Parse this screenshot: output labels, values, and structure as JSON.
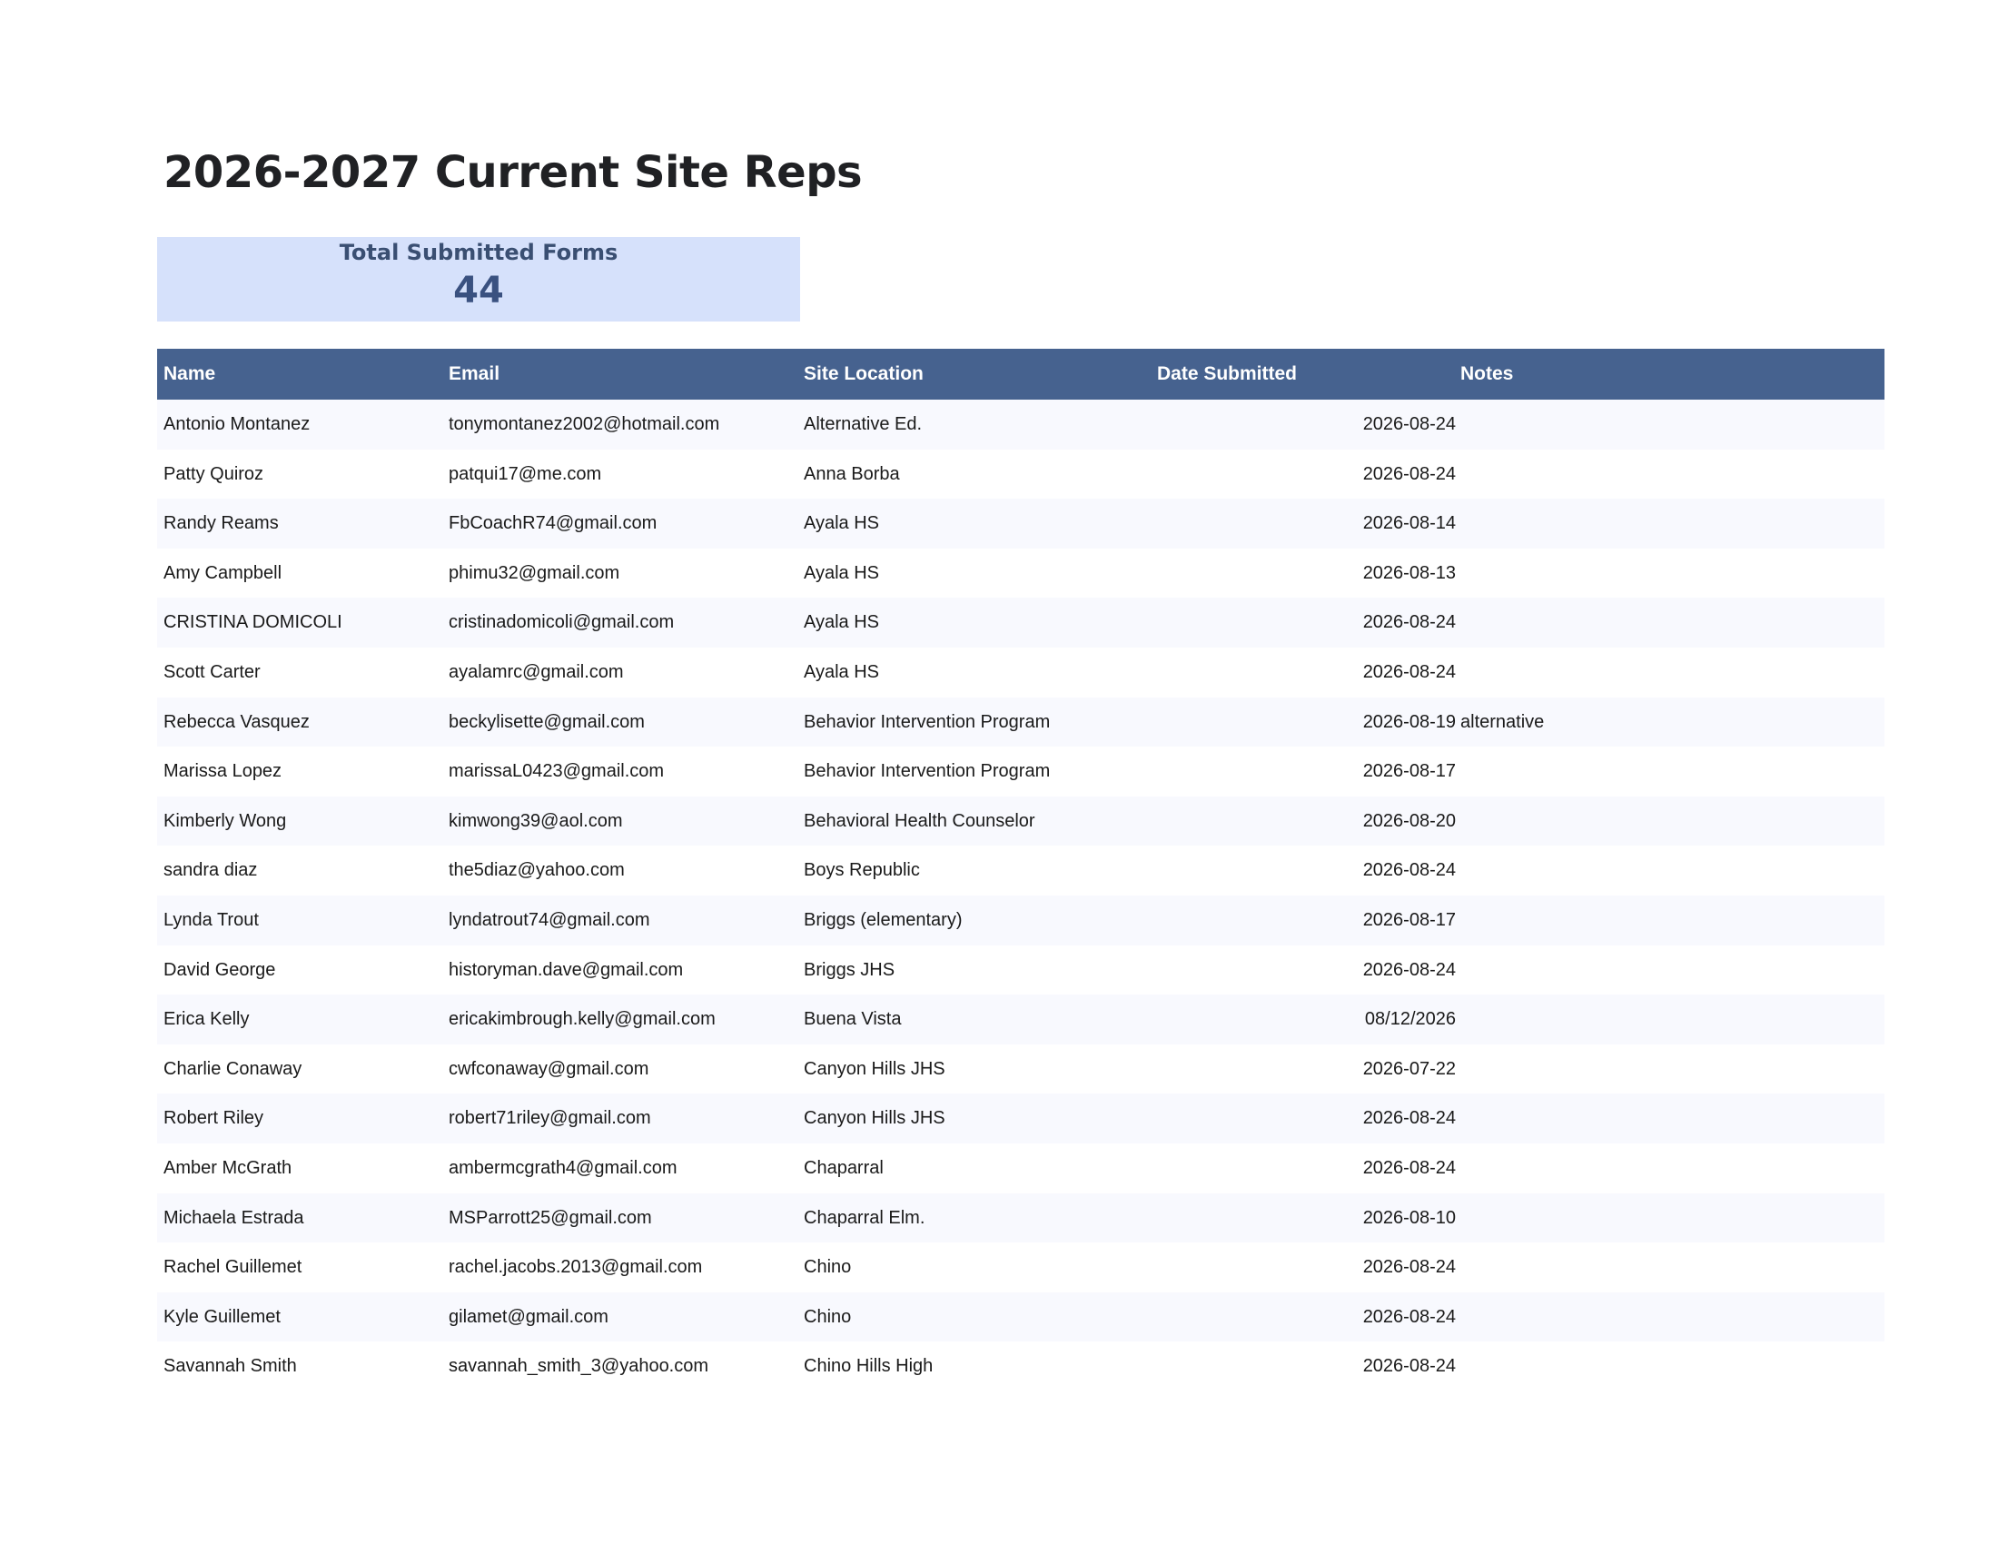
{
  "title": "2026-2027 Current Site Reps",
  "summary": {
    "label": "Total Submitted Forms",
    "value": "44"
  },
  "columns": {
    "name": "Name",
    "email": "Email",
    "site": "Site Location",
    "date": "Date Submitted",
    "notes": "Notes"
  },
  "rows": [
    {
      "name": "Antonio Montanez",
      "email": "tonymontanez2002@hotmail.com",
      "site": "Alternative Ed.",
      "date": "2026-08-24",
      "notes": ""
    },
    {
      "name": "Patty Quiroz",
      "email": "patqui17@me.com",
      "site": "Anna Borba",
      "date": "2026-08-24",
      "notes": ""
    },
    {
      "name": "Randy Reams",
      "email": "FbCoachR74@gmail.com",
      "site": "Ayala HS",
      "date": "2026-08-14",
      "notes": ""
    },
    {
      "name": "Amy Campbell",
      "email": "phimu32@gmail.com",
      "site": "Ayala HS",
      "date": "2026-08-13",
      "notes": ""
    },
    {
      "name": "CRISTINA DOMICOLI",
      "email": "cristinadomicoli@gmail.com",
      "site": "Ayala HS",
      "date": "2026-08-24",
      "notes": ""
    },
    {
      "name": "Scott Carter",
      "email": "ayalamrc@gmail.com",
      "site": "Ayala HS",
      "date": "2026-08-24",
      "notes": ""
    },
    {
      "name": "Rebecca Vasquez",
      "email": "beckylisette@gmail.com",
      "site": "Behavior Intervention Program",
      "date": "2026-08-19",
      "notes": "alternative"
    },
    {
      "name": "Marissa Lopez",
      "email": "marissaL0423@gmail.com",
      "site": "Behavior Intervention Program",
      "date": "2026-08-17",
      "notes": ""
    },
    {
      "name": "Kimberly Wong",
      "email": "kimwong39@aol.com",
      "site": "Behavioral Health Counselor",
      "date": "2026-08-20",
      "notes": ""
    },
    {
      "name": "sandra diaz",
      "email": "the5diaz@yahoo.com",
      "site": "Boys Republic",
      "date": "2026-08-24",
      "notes": ""
    },
    {
      "name": "Lynda Trout",
      "email": "lyndatrout74@gmail.com",
      "site": "Briggs (elementary)",
      "date": "2026-08-17",
      "notes": ""
    },
    {
      "name": "David George",
      "email": "historyman.dave@gmail.com",
      "site": "Briggs JHS",
      "date": "2026-08-24",
      "notes": ""
    },
    {
      "name": "Erica Kelly",
      "email": "ericakimbrough.kelly@gmail.com",
      "site": "Buena Vista",
      "date": "08/12/2026",
      "notes": ""
    },
    {
      "name": "Charlie Conaway",
      "email": "cwfconaway@gmail.com",
      "site": "Canyon Hills JHS",
      "date": "2026-07-22",
      "notes": ""
    },
    {
      "name": "Robert Riley",
      "email": "robert71riley@gmail.com",
      "site": "Canyon Hills JHS",
      "date": "2026-08-24",
      "notes": ""
    },
    {
      "name": "Amber McGrath",
      "email": "ambermcgrath4@gmail.com",
      "site": "Chaparral",
      "date": "2026-08-24",
      "notes": ""
    },
    {
      "name": "Michaela Estrada",
      "email": "MSParrott25@gmail.com",
      "site": "Chaparral Elm.",
      "date": "2026-08-10",
      "notes": ""
    },
    {
      "name": "Rachel Guillemet",
      "email": "rachel.jacobs.2013@gmail.com",
      "site": "Chino",
      "date": "2026-08-24",
      "notes": ""
    },
    {
      "name": "Kyle Guillemet",
      "email": "gilamet@gmail.com",
      "site": "Chino",
      "date": "2026-08-24",
      "notes": ""
    },
    {
      "name": "Savannah Smith",
      "email": "savannah_smith_3@yahoo.com",
      "site": "Chino Hills High",
      "date": "2026-08-24",
      "notes": ""
    }
  ]
}
